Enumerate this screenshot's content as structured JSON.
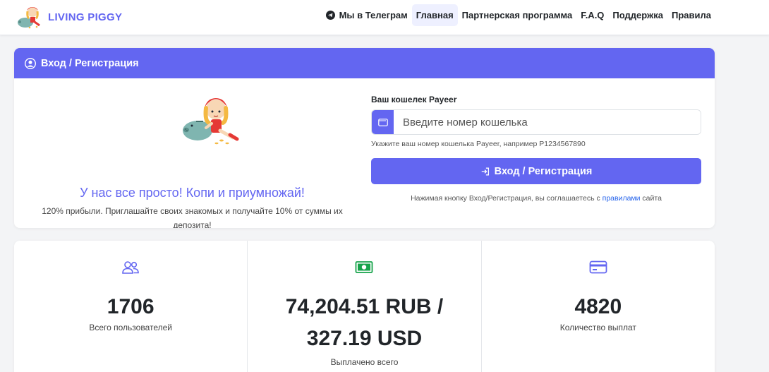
{
  "brand": {
    "name": "LIVING PIGGY",
    "logo_icon": "piggy-girl-logo"
  },
  "nav": {
    "telegram": "Мы в Телеграм",
    "home": "Главная",
    "partner": "Партнерская программа",
    "faq": "F.A.Q",
    "support": "Поддержка",
    "rules": "Правила",
    "active": "home"
  },
  "login": {
    "header": "Вход / Регистрация",
    "promo_title": "У нас все просто! Копи и приумножай!",
    "promo_text": "120% прибыли. Приглашайте своих знакомых и получайте 10% от суммы их депозита!",
    "wallet_label": "Ваш кошелек Payeer",
    "wallet_placeholder": "Введите номер кошелька",
    "wallet_help": "Укажите ваш номер кошелька Payeer, например P1234567890",
    "submit_label": "Вход / Регистрация",
    "terms_prefix": "Нажимая кнопку Вход/Регистрация, вы соглашаетесь с ",
    "terms_link": "правилами",
    "terms_suffix": " сайта"
  },
  "stats": {
    "users_value": "1706",
    "users_label": "Всего пользователей",
    "paid_rub": "74,204.51 RUB /",
    "paid_usd": "327.19 USD",
    "paid_label": "Выплачено всего",
    "payouts_value": "4820",
    "payouts_label": "Количество выплат"
  },
  "colors": {
    "accent": "#6366f1",
    "money_icon": "#16a34a",
    "link": "#2563eb"
  }
}
